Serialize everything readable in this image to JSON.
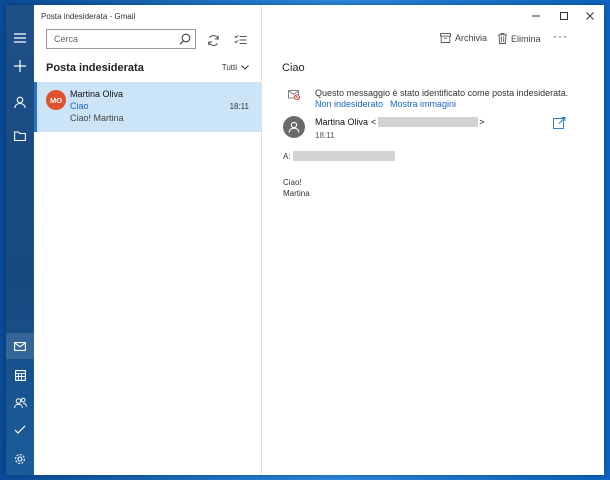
{
  "window": {
    "title": "Posta indesiderata - Gmail"
  },
  "colors": {
    "accent": "#1a66c7",
    "selection": "#cce4f7",
    "avatar_bg": "#e2502c",
    "rail_bg": "#1e4f86"
  },
  "rail": {
    "top_icons": [
      "hamburger-icon",
      "plus-icon",
      "person-icon",
      "folder-icon"
    ],
    "bottom_icons": [
      "mail-icon",
      "calendar-icon",
      "people-icon",
      "todo-icon",
      "gear-icon"
    ]
  },
  "search": {
    "placeholder": "Cerca",
    "value": ""
  },
  "list": {
    "folder_title": "Posta indesiderata",
    "filter_label": "Tutti",
    "messages": [
      {
        "initials": "MO",
        "sender": "Martina Oliva",
        "subject": "Ciao",
        "time": "18:11",
        "preview": "Ciao! Martina"
      }
    ]
  },
  "reading": {
    "toolbar": {
      "archive_label": "Archivia",
      "delete_label": "Elimina",
      "more_label": "···"
    },
    "subject": "Ciao",
    "junk_notice": "Questo messaggio è stato identificato come posta indesiderata.",
    "not_junk_link": "Non indesiderato",
    "show_images_link": "Mostra immagini",
    "from_name": "Martina Oliva",
    "from_lt": "<",
    "from_gt": ">",
    "time": "18:11",
    "to_label": "A:",
    "body": [
      "Ciao!",
      "Martina"
    ]
  }
}
